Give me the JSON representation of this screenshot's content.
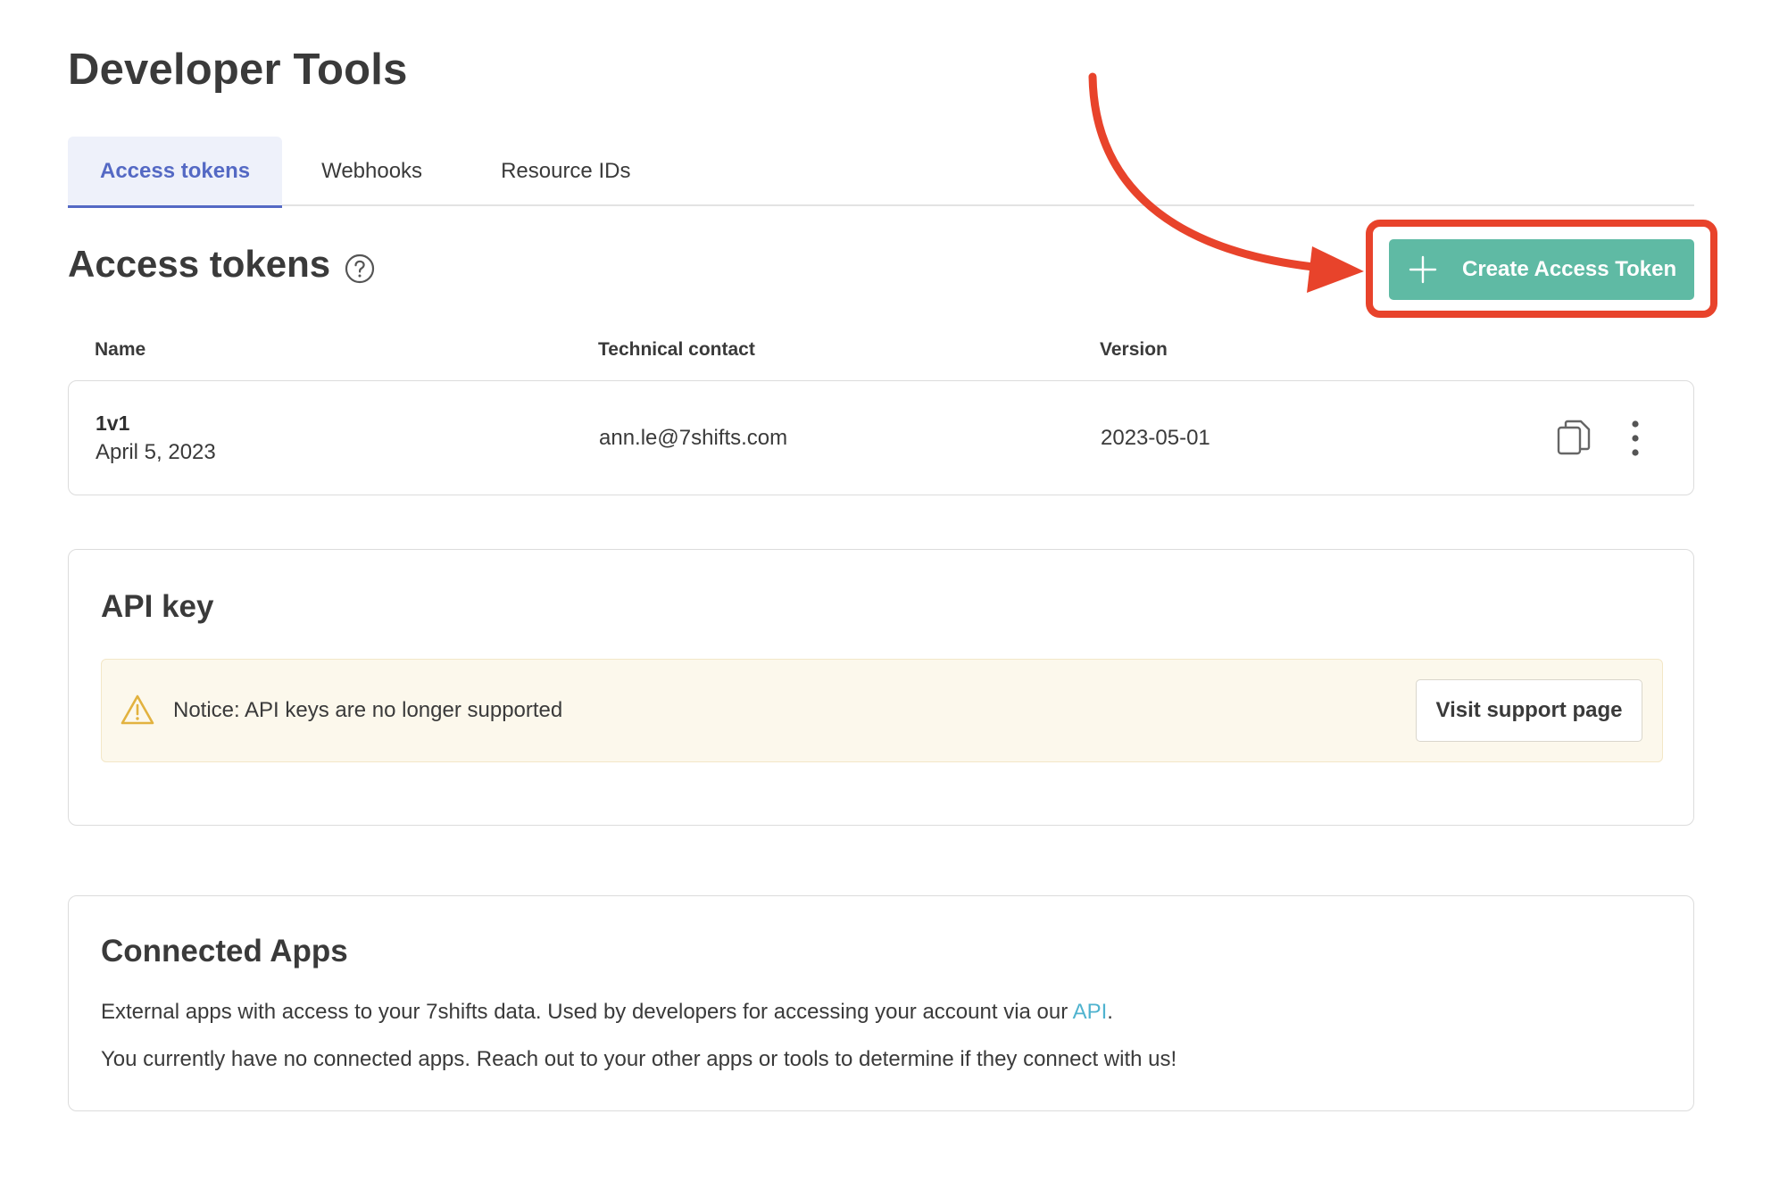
{
  "page": {
    "title": "Developer Tools"
  },
  "tabs": [
    {
      "label": "Access tokens",
      "active": true
    },
    {
      "label": "Webhooks",
      "active": false
    },
    {
      "label": "Resource IDs",
      "active": false
    }
  ],
  "access_tokens": {
    "title": "Access tokens",
    "help_icon": "question-circle-icon",
    "create_button_label": "Create Access Token",
    "columns": [
      "Name",
      "Technical contact",
      "Version"
    ],
    "rows": [
      {
        "name": "1v1",
        "date": "April 5, 2023",
        "contact": "ann.le@7shifts.com",
        "version": "2023-05-01"
      }
    ]
  },
  "api_key": {
    "title": "API key",
    "notice_text": "Notice: API keys are no longer supported",
    "support_button_label": "Visit support page"
  },
  "connected_apps": {
    "title": "Connected Apps",
    "description_before_link": "External apps with access to your 7shifts data. Used by developers for accessing your account via our ",
    "link_text": "API",
    "description_after_link": ".",
    "empty_message": "You currently have no connected apps. Reach out to your other apps or tools to determine if they connect with us!"
  },
  "colors": {
    "accent_tab": "#5469c4",
    "primary_button": "#5fbaa4",
    "annotation_red": "#e8432b",
    "link": "#4fb3cf",
    "notice_bg": "#fcf8ec",
    "warning": "#e2b23f"
  }
}
